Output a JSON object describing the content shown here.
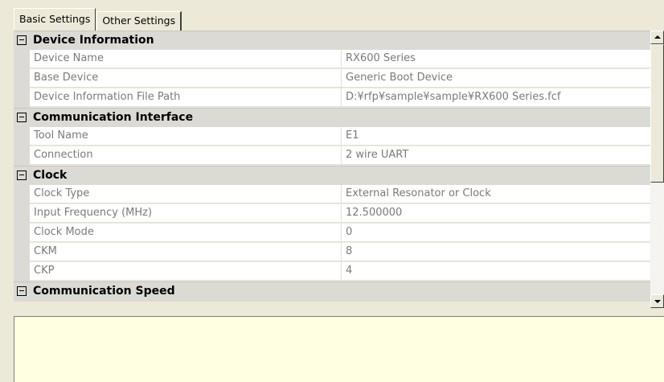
{
  "tabs": [
    {
      "label": "Basic Settings",
      "active": true
    },
    {
      "label": "Other Settings",
      "active": false
    }
  ],
  "grid": {
    "categories": [
      {
        "label": "Device Information",
        "expanded": true,
        "properties": [
          {
            "name": "Device Name",
            "value": "RX600 Series"
          },
          {
            "name": "Base Device",
            "value": "Generic Boot Device"
          },
          {
            "name": "Device Information File Path",
            "value": "D:¥rfp¥sample¥sample¥RX600 Series.fcf"
          }
        ]
      },
      {
        "label": "Communication Interface",
        "expanded": true,
        "properties": [
          {
            "name": "Tool Name",
            "value": "E1"
          },
          {
            "name": "Connection",
            "value": "2 wire UART"
          }
        ]
      },
      {
        "label": "Clock",
        "expanded": true,
        "properties": [
          {
            "name": "Clock Type",
            "value": "External Resonator or Clock"
          },
          {
            "name": "Input Frequency (MHz)",
            "value": "12.500000"
          },
          {
            "name": "Clock Mode",
            "value": "0"
          },
          {
            "name": "CKM",
            "value": "8"
          },
          {
            "name": "CKP",
            "value": "4"
          }
        ]
      },
      {
        "label": "Communication Speed",
        "expanded": true,
        "properties": []
      }
    ]
  },
  "scrollbar": {
    "position": 0,
    "visible_fraction": 0.55
  },
  "description": {
    "text": ""
  },
  "colors": {
    "category_bg": "#dcdad5",
    "cell_bg": "#ffffff",
    "description_bg": "#ffffe1",
    "window_bg": "#ece9d8"
  }
}
